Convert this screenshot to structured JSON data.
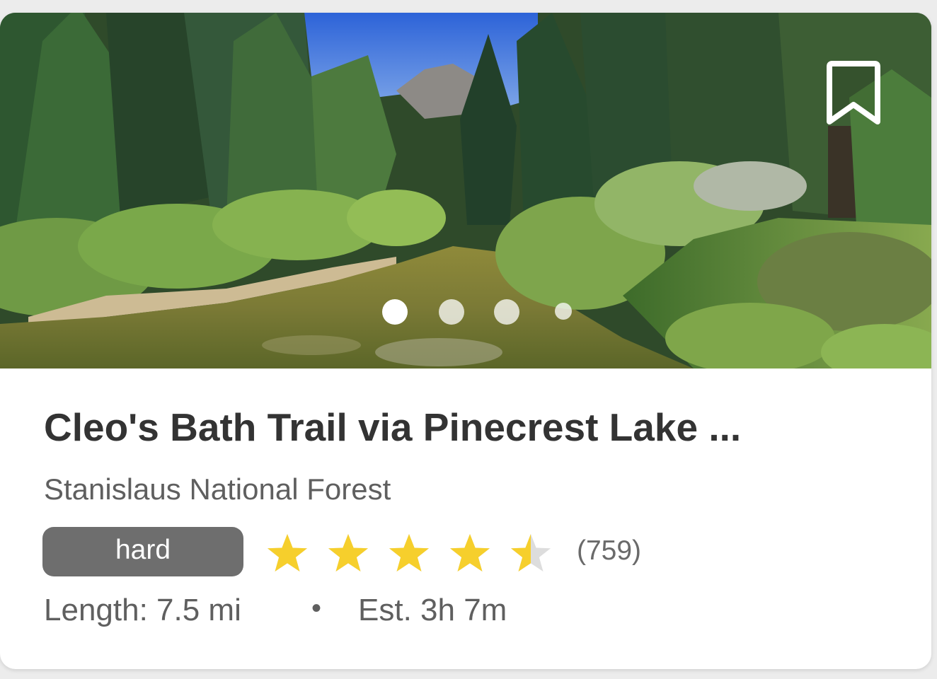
{
  "trail": {
    "title": "Cleo's Bath Trail via Pinecrest Lake ...",
    "location": "Stanislaus National Forest",
    "difficulty": "hard",
    "rating": 4.5,
    "rating_max": 5,
    "review_count": "(759)",
    "length": "Length: 7.5 mi",
    "separator": "•",
    "estimated_time": "Est. 3h 7m"
  },
  "photo_carousel": {
    "total_slides": 4,
    "active_slide": 1
  },
  "icons": {
    "bookmark": "bookmark-icon",
    "star": "star-icon"
  },
  "colors": {
    "title": "#333333",
    "secondary_text": "#5f5f5f",
    "badge_bg": "#6e6e6e",
    "star_filled": "#f6cf2c",
    "star_empty": "#dddddd"
  }
}
